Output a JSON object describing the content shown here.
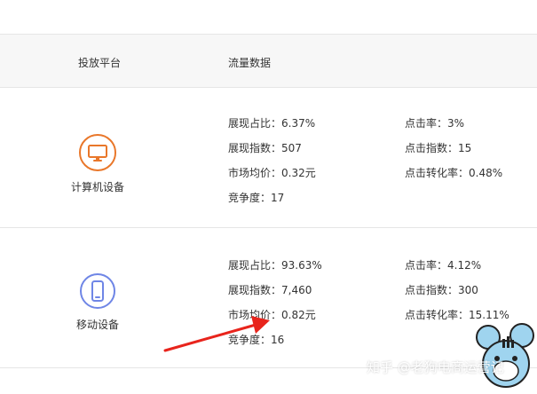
{
  "header": {
    "platform_col": "投放平台",
    "data_col": "流量数据"
  },
  "sections": [
    {
      "platform": "计算机设备",
      "icon": "desktop-monitor-icon",
      "accent": "#e9772a",
      "left": [
        {
          "label": "展现占比",
          "value": "6.37%"
        },
        {
          "label": "展现指数",
          "value": "507"
        },
        {
          "label": "市场均价",
          "value": "0.32元"
        },
        {
          "label": "竞争度",
          "value": "17"
        }
      ],
      "right": [
        {
          "label": "点击率",
          "value": "3%"
        },
        {
          "label": "点击指数",
          "value": "15"
        },
        {
          "label": "点击转化率",
          "value": "0.48%"
        }
      ]
    },
    {
      "platform": "移动设备",
      "icon": "mobile-phone-icon",
      "accent": "#6f86e6",
      "left": [
        {
          "label": "展现占比",
          "value": "93.63%"
        },
        {
          "label": "展现指数",
          "value": "7,460"
        },
        {
          "label": "市场均价",
          "value": "0.82元"
        },
        {
          "label": "竞争度",
          "value": "16"
        }
      ],
      "right": [
        {
          "label": "点击率",
          "value": "4.12%"
        },
        {
          "label": "点击指数",
          "value": "300"
        },
        {
          "label": "点击转化率",
          "value": "15.11%"
        }
      ]
    }
  ],
  "separator": "：",
  "annotation": {
    "color": "#e8241c"
  },
  "watermark": "知乎 @老狗电商运营记"
}
